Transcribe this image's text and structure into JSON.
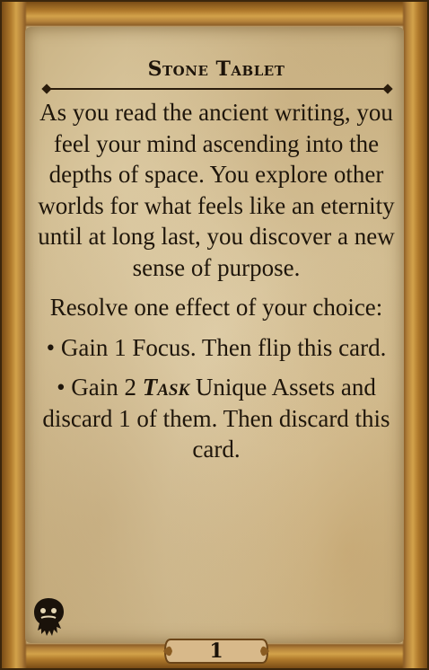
{
  "card": {
    "title": "Stone Tablet",
    "flavor_text": "As you read the ancient writing, you feel your mind ascending into the depths of space. You explore other worlds for what feels like an eternity until at long last, you discover a new sense of purpose.",
    "instruction": "Resolve one effect of your choice:",
    "options": [
      {
        "bullet": "•",
        "text_before": "Gain 1 Focus. Then flip this card.",
        "keyword": "",
        "text_after": ""
      },
      {
        "bullet": "•",
        "text_before": "Gain 2 ",
        "keyword": "Task",
        "text_after": " Unique Assets and discard 1 of them. Then discard this card."
      }
    ],
    "number": "1",
    "icon": "cthulhu-head-icon"
  },
  "colors": {
    "frame": "#b07a2c",
    "parchment": "#e6d7b4",
    "ink": "#1f160b"
  }
}
